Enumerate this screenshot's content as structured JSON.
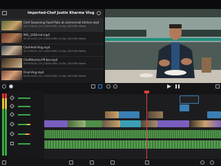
{
  "browser": {
    "title": "Imported-Chef Justin Kharma Vlog",
    "clips": [
      {
        "title": "Chef Seasoning Food Plate at commercial kitchen.mp4",
        "meta": "00:17:16;00 | 24 | 1920×1080 | 24 fps | 48.0 KHz Stereo"
      },
      {
        "title": "IMG_1458.m4.mp4",
        "meta": "00:15:21;00 | 24 | 1920×1080 | 24 fps | 48.0 KHz Stereo"
      },
      {
        "title": "Chef-Hell-Vlog.mp4",
        "meta": "00:13:05;00 | 24 | 1920×1080 | 24 fps | 48.0 KHz Stereo"
      },
      {
        "title": "ChefKharma-PR-bar.mp4",
        "meta": "00:03:20;00 | 24 | 1920×1080 | 24 fps | 48.0 KHz Stereo"
      },
      {
        "title": "Final-Vlog.mp4",
        "meta": "00:09:12;00 | 24 | 1920×1080 | 24 fps | 48.0 KHz Stereo"
      }
    ]
  },
  "colors": {
    "accent": "#2f7fd9",
    "clip_blue": "#3a7fb4",
    "clip_purple": "#7a5fbf",
    "clip_green": "#4f8f4a",
    "audio_green": "#3e7a3a",
    "playhead": "#e04141"
  },
  "icons": {
    "browser_folder": "folder-icon",
    "browser_info": "info-icon",
    "viewer_fullscreen": "fullscreen-icon"
  }
}
